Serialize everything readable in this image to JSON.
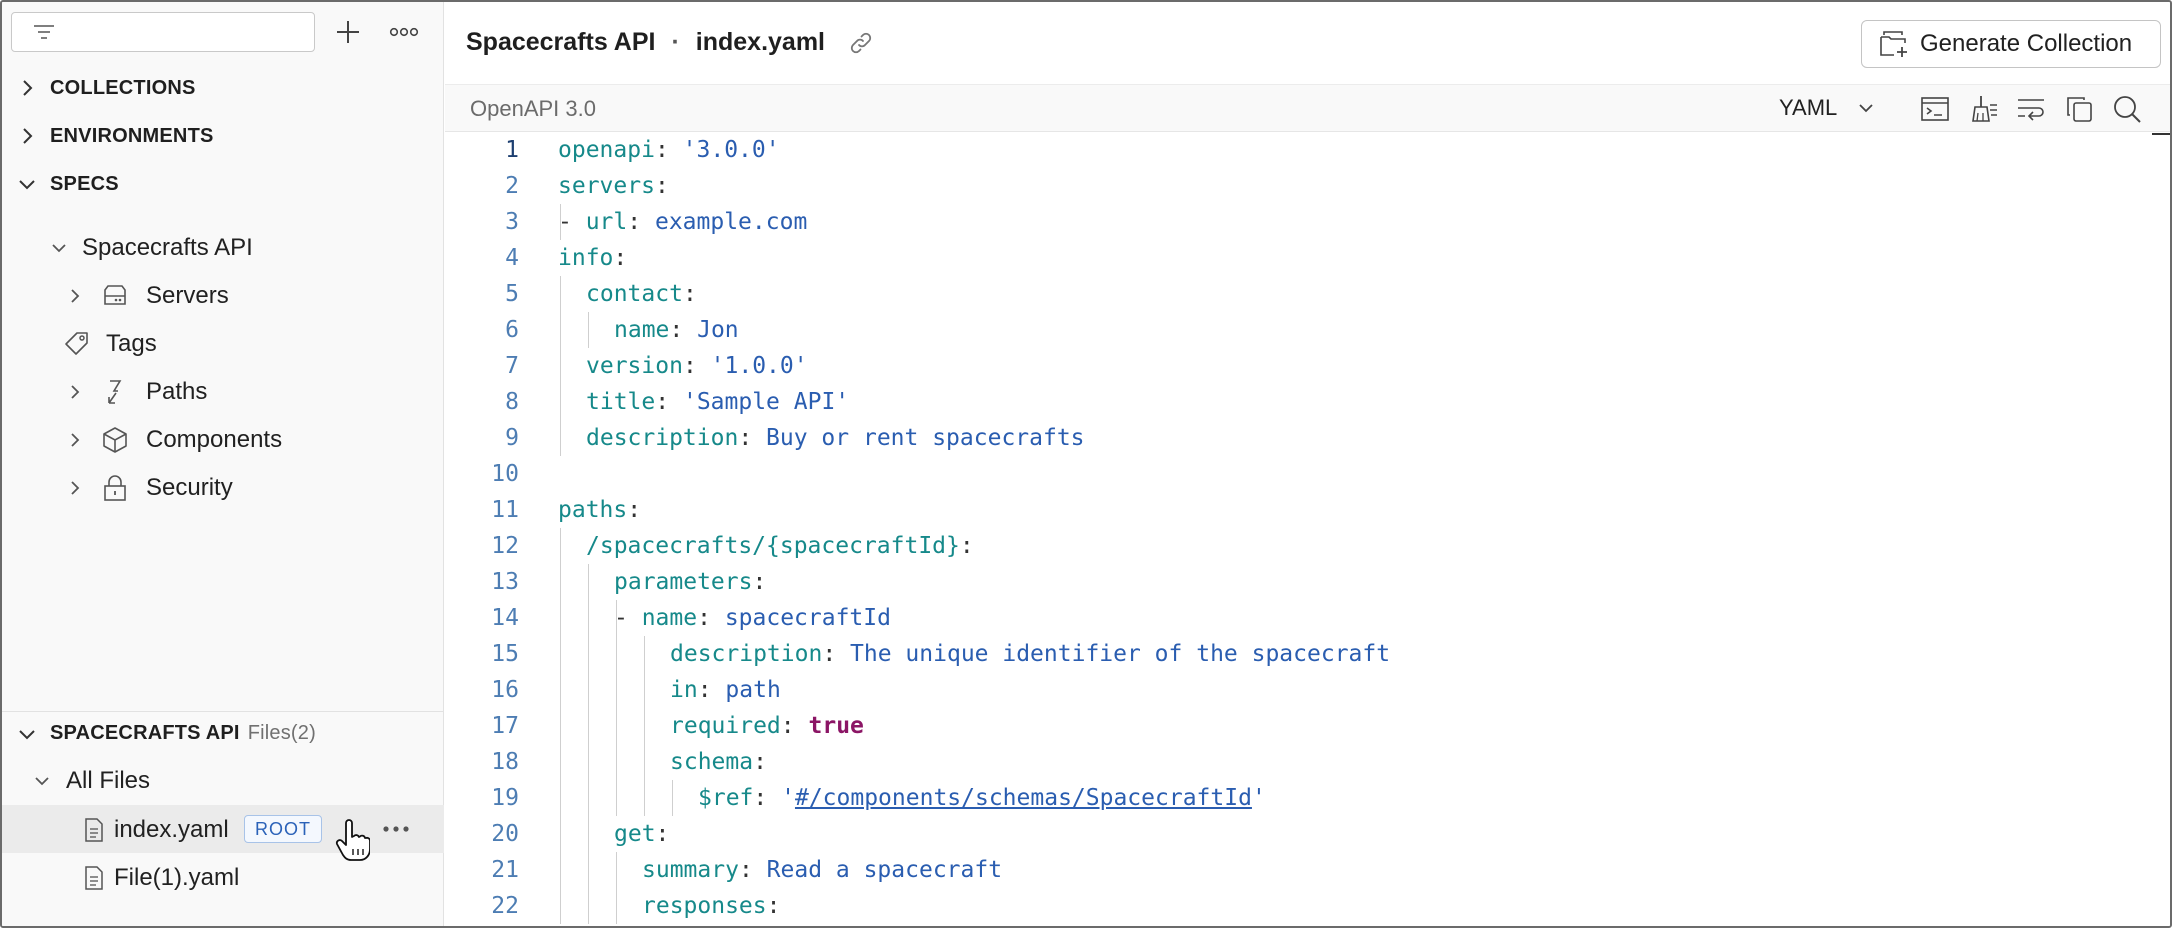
{
  "sidebar": {
    "filter_placeholder": "",
    "sections": [
      {
        "label": "COLLECTIONS"
      },
      {
        "label": "ENVIRONMENTS"
      },
      {
        "label": "SPECS"
      }
    ],
    "spec_tree": {
      "root": "Spacecrafts API",
      "items": [
        {
          "label": "Servers",
          "icon": "server-icon"
        },
        {
          "label": "Tags",
          "icon": "tag-icon"
        },
        {
          "label": "Paths",
          "icon": "paths-icon"
        },
        {
          "label": "Components",
          "icon": "cube-icon"
        },
        {
          "label": "Security",
          "icon": "lock-icon"
        }
      ]
    },
    "files_panel": {
      "title": "SPACECRAFTS API",
      "count": "Files(2)",
      "folder": "All Files",
      "files": [
        {
          "name": "index.yaml",
          "badge": "ROOT",
          "selected": true
        },
        {
          "name": "File(1).yaml"
        }
      ]
    }
  },
  "header": {
    "api_name": "Spacecrafts API",
    "separator": "·",
    "file_name": "index.yaml",
    "generate_label": "Generate Collection"
  },
  "toolbar": {
    "version": "OpenAPI 3.0",
    "format": "YAML"
  },
  "editor": {
    "active_line": 1,
    "lines": [
      {
        "n": "1",
        "indent": 0,
        "key": "openapi",
        "value": "'3.0.0'"
      },
      {
        "n": "2",
        "indent": 0,
        "key": "servers",
        "value": ""
      },
      {
        "n": "3",
        "indent": 1,
        "dash": true,
        "key": "url",
        "value": "example.com"
      },
      {
        "n": "4",
        "indent": 0,
        "key": "info",
        "value": ""
      },
      {
        "n": "5",
        "indent": 1,
        "key": "contact",
        "value": ""
      },
      {
        "n": "6",
        "indent": 2,
        "key": "name",
        "value": "Jon"
      },
      {
        "n": "7",
        "indent": 1,
        "key": "version",
        "value": "'1.0.0'"
      },
      {
        "n": "8",
        "indent": 1,
        "key": "title",
        "value": "'Sample API'"
      },
      {
        "n": "9",
        "indent": 1,
        "key": "description",
        "value": "Buy or rent spacecrafts"
      },
      {
        "n": "10",
        "indent": 0,
        "key": "",
        "value": ""
      },
      {
        "n": "11",
        "indent": 0,
        "key": "paths",
        "value": ""
      },
      {
        "n": "12",
        "indent": 1,
        "key": "/spacecrafts/{spacecraftId}",
        "value": ""
      },
      {
        "n": "13",
        "indent": 2,
        "key": "parameters",
        "value": ""
      },
      {
        "n": "14",
        "indent": 3,
        "dash": true,
        "key": "name",
        "value": "spacecraftId"
      },
      {
        "n": "15",
        "indent": 4,
        "key": "description",
        "value": "The unique identifier of the spacecraft"
      },
      {
        "n": "16",
        "indent": 4,
        "key": "in",
        "value": "path"
      },
      {
        "n": "17",
        "indent": 4,
        "key": "required",
        "value": "true",
        "bool": true
      },
      {
        "n": "18",
        "indent": 4,
        "key": "schema",
        "value": ""
      },
      {
        "n": "19",
        "indent": 5,
        "key": "$ref",
        "value": "'#/components/schemas/SpacecraftId'",
        "ref": true
      },
      {
        "n": "20",
        "indent": 2,
        "key": "get",
        "value": ""
      },
      {
        "n": "21",
        "indent": 3,
        "key": "summary",
        "value": "Read a spacecraft"
      },
      {
        "n": "22",
        "indent": 3,
        "key": "responses",
        "value": ""
      }
    ]
  },
  "colors": {
    "key": "#16898a",
    "string": "#2a5db0",
    "boolean": "#8b1565",
    "line_number": "#4d7db3",
    "badge": "#2b62b8"
  }
}
